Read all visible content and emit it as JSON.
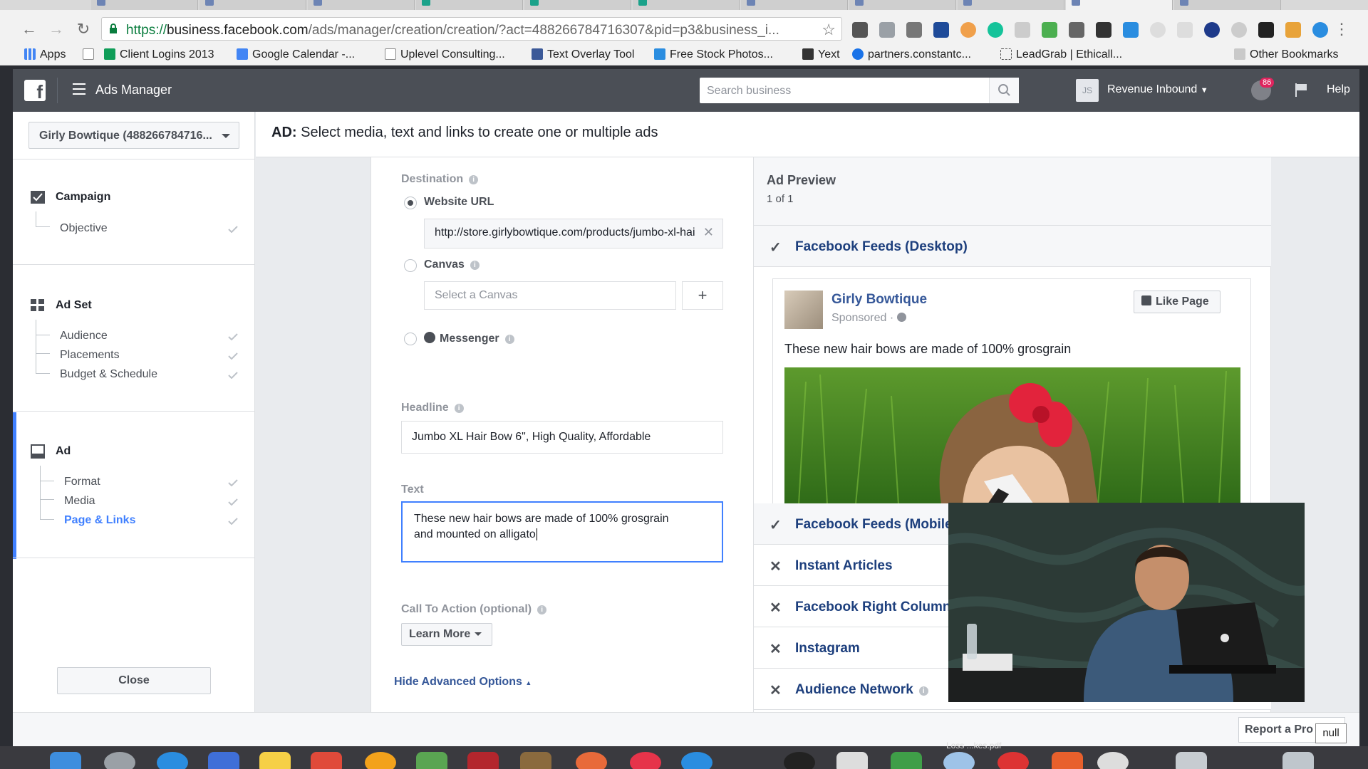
{
  "browser": {
    "url_scheme": "https://",
    "url_host": "business.facebook.com",
    "url_path": "/ads/manager/creation/creation/?act=488266784716307&pid=p3&business_i...",
    "bookmarks": [
      "Apps",
      "Client Logins 2013",
      "Google Calendar -...",
      "Uplevel Consulting...",
      "Text Overlay Tool",
      "Free Stock Photos...",
      "Yext",
      "partners.constantc...",
      "LeadGrab | Ethicall...",
      "Other Bookmarks"
    ]
  },
  "topbar": {
    "app_title": "Ads Manager",
    "search_placeholder": "Search business",
    "account_initials": "JS",
    "account_name": "Revenue Inbound",
    "notification_count": "86",
    "help_label": "Help"
  },
  "sidebar": {
    "account_selector": "Girly Bowtique (488266784716...",
    "campaign": {
      "label": "Campaign",
      "items": [
        "Objective"
      ]
    },
    "adset": {
      "label": "Ad Set",
      "items": [
        "Audience",
        "Placements",
        "Budget & Schedule"
      ]
    },
    "ad": {
      "label": "Ad",
      "items": [
        "Format",
        "Media",
        "Page & Links"
      ]
    },
    "close_label": "Close"
  },
  "header": {
    "prefix": "AD:",
    "title": "Select media, text and links to create one or multiple ads"
  },
  "form": {
    "destination_label": "Destination",
    "website_url_label": "Website URL",
    "website_url_value": "http://store.girlybowtique.com/products/jumbo-xl-hai",
    "canvas_label": "Canvas",
    "canvas_placeholder": "Select a Canvas",
    "add_symbol": "+",
    "messenger_label": "Messenger",
    "headline_label": "Headline",
    "headline_value": "Jumbo XL Hair Bow 6\", High Quality, Affordable",
    "text_label": "Text",
    "text_line1": "These new hair bows are made of 100% grosgrain",
    "text_line2": "and mounted on alligato",
    "cta_label": "Call To Action (optional)",
    "cta_value": "Learn More",
    "advanced_link": "Hide Advanced Options"
  },
  "preview": {
    "title": "Ad Preview",
    "count": "1 of 1",
    "page_name": "Girly Bowtique",
    "sponsored": "Sponsored ·",
    "like_label": "Like Page",
    "ad_text": "These new hair bows are made of 100% grosgrain",
    "placements": [
      {
        "label": "Facebook Feeds (Desktop)",
        "enabled": true
      },
      {
        "label": "Facebook Feeds (Mobile)",
        "enabled": true
      },
      {
        "label": "Instant Articles",
        "enabled": false
      },
      {
        "label": "Facebook Right Column",
        "enabled": false
      },
      {
        "label": "Instagram",
        "enabled": false
      },
      {
        "label": "Audience Network",
        "enabled": false
      }
    ]
  },
  "footer": {
    "report_label": "Report a Pro",
    "tooltip": "null",
    "dock_label": "Loss ...kes.pdf"
  },
  "colors": {
    "fb_bar": "#4b4f56",
    "accent_blue": "#4080ff",
    "link_blue": "#365899"
  }
}
